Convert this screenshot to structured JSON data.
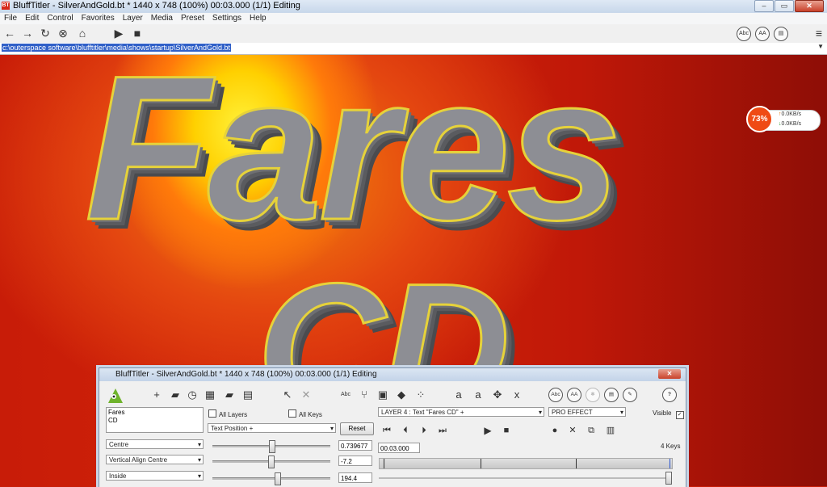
{
  "window": {
    "title": "BluffTitler - SilverAndGold.bt * 1440 x 748 (100%) 00:03.000 (1/1) Editing",
    "app_icon_text": "BT"
  },
  "menu": [
    "File",
    "Edit",
    "Control",
    "Favorites",
    "Layer",
    "Media",
    "Preset",
    "Settings",
    "Help"
  ],
  "toolbar": {
    "round_buttons": [
      "Abc",
      "AA",
      "doc"
    ]
  },
  "address": {
    "path": "c:\\outerspace software\\blufftitler\\media\\shows\\startup\\SilverAndGold.bt"
  },
  "scene": {
    "line1": "Fares",
    "line2": "CD"
  },
  "speed_widget": {
    "percent": "73%",
    "upload": "0.0KB/s",
    "download": "0.0KB/s"
  },
  "panel": {
    "title": "BluffTitler - SilverAndGold.bt * 1440 x 748 (100%) 00:03.000 (1/1) Editing",
    "layers": [
      "Fares",
      "CD"
    ],
    "all_layers_label": "All Layers",
    "all_keys_label": "All Keys",
    "property_select": "Text Position +",
    "reset_label": "Reset",
    "layer_select": "LAYER 4 : Text \"Fares CD\" +",
    "effect_select": "PRO EFFECT",
    "visible_label": "Visible",
    "visible_checked": true,
    "rows": [
      {
        "dropdown": "Centre",
        "value": "0.739677",
        "level": 0.5
      },
      {
        "dropdown": "Vertical Align Centre",
        "value": "-7.2",
        "level": 0.49
      },
      {
        "dropdown": "Inside",
        "value": "194.4",
        "level": 0.55
      }
    ],
    "time": "00.03.000",
    "keys_count": "4 Keys",
    "text_tool_labels": [
      "Abc",
      "a",
      "a",
      "x"
    ],
    "round_buttons": [
      "Abc",
      "AA"
    ]
  }
}
